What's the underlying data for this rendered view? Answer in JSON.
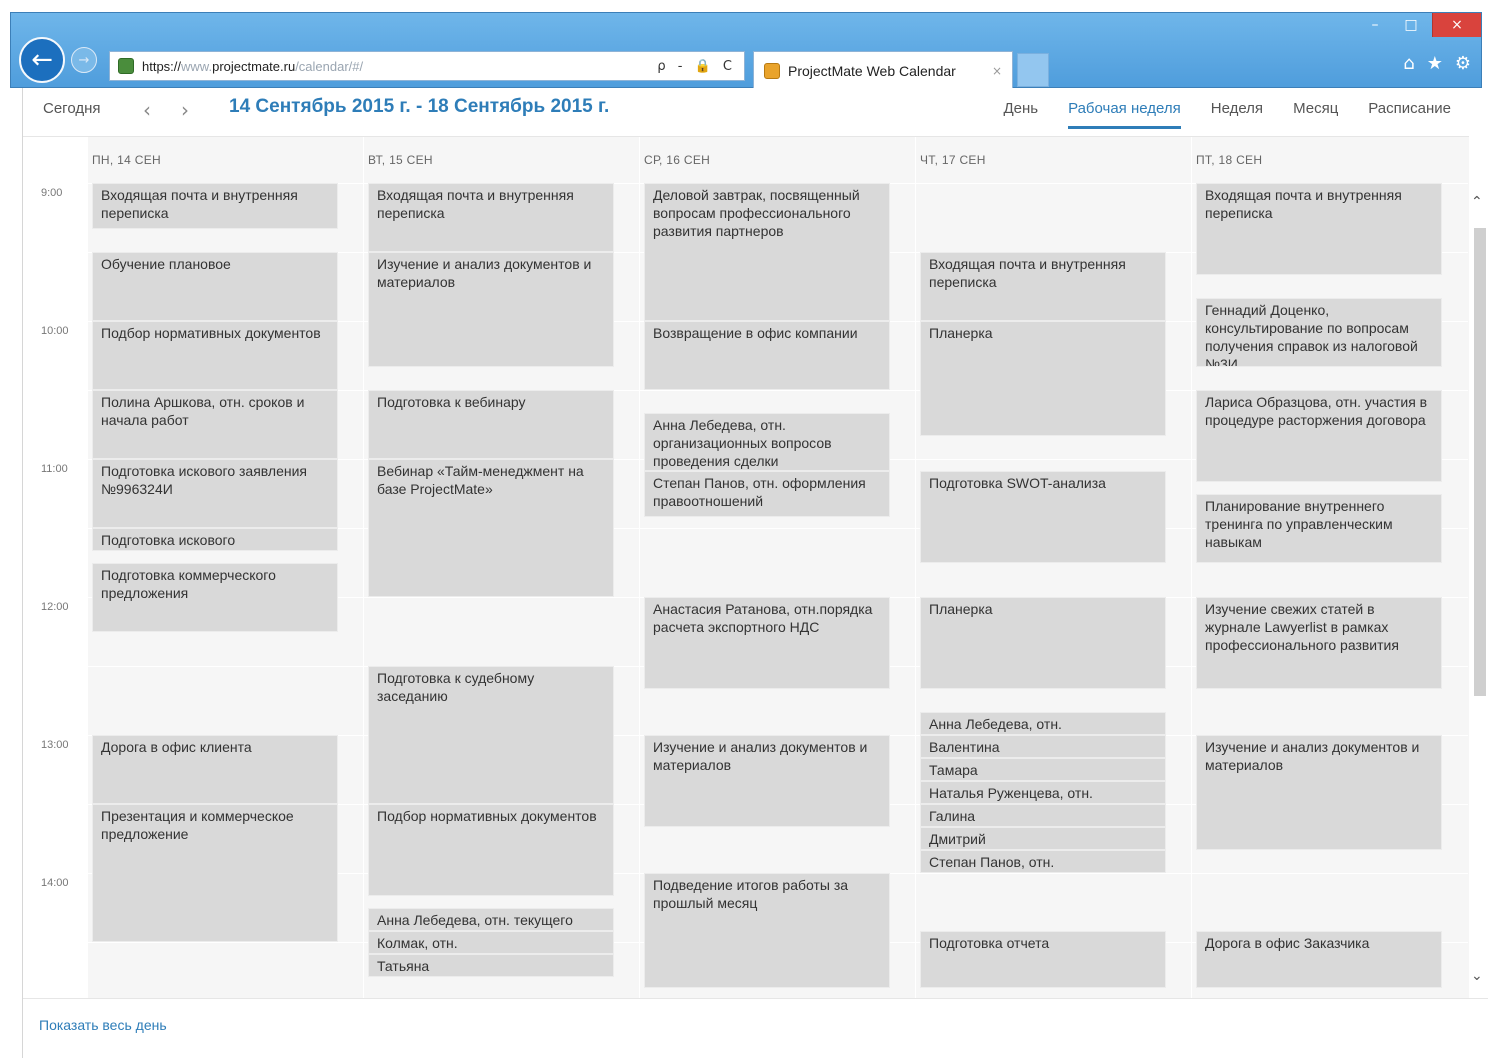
{
  "browser": {
    "url_scheme": "https://",
    "url_muted_prefix": "www.",
    "url_host": "projectmate.ru",
    "url_path": "/calendar/#/",
    "address_tools": "ρ - 🔒 C",
    "tab_title": "ProjectMate Web Calendar",
    "tab_close": "×",
    "window_min": "–",
    "window_max": "□",
    "window_close": "×",
    "tools": [
      "⌂",
      "★",
      "⚙"
    ]
  },
  "toolbar": {
    "today_label": "Сегодня",
    "prev_label": "‹",
    "next_label": "›",
    "date_range": "14 Сентябрь 2015 г. - 18 Сентябрь 2015 г.",
    "views": [
      {
        "label": "День",
        "active": false
      },
      {
        "label": "Рабочая неделя",
        "active": true
      },
      {
        "label": "Неделя",
        "active": false
      },
      {
        "label": "Месяц",
        "active": false
      },
      {
        "label": "Расписание",
        "active": false
      }
    ]
  },
  "time_labels": [
    "9:00",
    "10:00",
    "11:00",
    "12:00",
    "13:00",
    "14:00"
  ],
  "days": [
    {
      "header": "ПН, 14 СЕН",
      "events": [
        {
          "title": "Входящая почта и внутренняя переписка",
          "start": "9:00",
          "end": "9:20"
        },
        {
          "title": "Обучение плановое",
          "start": "9:30",
          "end": "10:00"
        },
        {
          "title": "Подбор нормативных документов",
          "start": "10:00",
          "end": "10:30"
        },
        {
          "title": "Полина Аршкова, отн. сроков и начала работ",
          "start": "10:30",
          "end": "11:00"
        },
        {
          "title": "Подготовка искового заявления №996324И",
          "start": "11:00",
          "end": "11:30"
        },
        {
          "title": "Подготовка искового",
          "start": "11:30",
          "end": "11:40"
        },
        {
          "title": "Подготовка коммерческого предложения",
          "start": "11:45",
          "end": "12:15"
        },
        {
          "title": "Дорога в офис клиента",
          "start": "13:00",
          "end": "13:30"
        },
        {
          "title": "Презентация и коммерческое предложение",
          "start": "13:30",
          "end": "14:30"
        }
      ]
    },
    {
      "header": "ВТ, 15 СЕН",
      "events": [
        {
          "title": "Входящая почта и внутренняя переписка",
          "start": "9:00",
          "end": "9:30"
        },
        {
          "title": "Изучение и анализ документов и материалов",
          "start": "9:30",
          "end": "10:20"
        },
        {
          "title": "Подготовка к вебинару",
          "start": "10:30",
          "end": "11:00"
        },
        {
          "title": "Вебинар «Тайм-менеджмент на базе ProjectMate»",
          "start": "11:00",
          "end": "12:00"
        },
        {
          "title": "Подготовка к судебному заседанию",
          "start": "12:30",
          "end": "13:30"
        },
        {
          "title": "Подбор нормативных документов",
          "start": "13:30",
          "end": "14:10"
        },
        {
          "title": "Анна Лебедева, отн. текущего",
          "start": "14:15",
          "end": "14:25"
        },
        {
          "title": "Колмак, отн.",
          "start": "14:25",
          "end": "14:35"
        },
        {
          "title": "Татьяна",
          "start": "14:35",
          "end": "14:45"
        }
      ]
    },
    {
      "header": "СР, 16 СЕН",
      "events": [
        {
          "title": "Деловой завтрак, посвященный вопросам профессионального развития партнеров",
          "start": "9:00",
          "end": "10:00"
        },
        {
          "title": "Возвращение в офис компании",
          "start": "10:00",
          "end": "10:30"
        },
        {
          "title": "Анна Лебедева, отн. организационных вопросов проведения сделки",
          "start": "10:40",
          "end": "11:05"
        },
        {
          "title": "Степан Панов, отн. оформления правоотношений",
          "start": "11:05",
          "end": "11:25"
        },
        {
          "title": "Анастасия Ратанова, отн.порядка расчета экспортного НДС",
          "start": "12:00",
          "end": "12:40"
        },
        {
          "title": "Изучение и анализ документов и материалов",
          "start": "13:00",
          "end": "13:40"
        },
        {
          "title": "Подведение итогов работы за прошлый месяц",
          "start": "14:00",
          "end": "14:50"
        }
      ]
    },
    {
      "header": "ЧТ, 17 СЕН",
      "events": [
        {
          "title": "Входящая почта и внутренняя переписка",
          "start": "9:30",
          "end": "10:00"
        },
        {
          "title": "Планерка",
          "start": "10:00",
          "end": "10:50"
        },
        {
          "title": "Подготовка SWOT-анализа",
          "start": "11:05",
          "end": "11:45"
        },
        {
          "title": "Планерка",
          "start": "12:00",
          "end": "12:40"
        },
        {
          "title": "Анна Лебедева, отн.",
          "start": "12:50",
          "end": "13:00"
        },
        {
          "title": "Валентина",
          "start": "13:00",
          "end": "13:10"
        },
        {
          "title": "Тамара",
          "start": "13:10",
          "end": "13:20"
        },
        {
          "title": "Наталья Руженцева, отн.",
          "start": "13:20",
          "end": "13:30"
        },
        {
          "title": "Галина",
          "start": "13:30",
          "end": "13:40"
        },
        {
          "title": "Дмитрий",
          "start": "13:40",
          "end": "13:50"
        },
        {
          "title": "Степан Панов, отн.",
          "start": "13:50",
          "end": "14:00"
        },
        {
          "title": "Подготовка отчета",
          "start": "14:25",
          "end": "14:50"
        }
      ]
    },
    {
      "header": "ПТ, 18 СЕН",
      "events": [
        {
          "title": "Входящая почта и внутренняя переписка",
          "start": "9:00",
          "end": "9:40"
        },
        {
          "title": "Геннадий Доценко, консультирование по вопросам получения справок из налоговой №3И",
          "start": "9:50",
          "end": "10:20"
        },
        {
          "title": "Лариса Образцова, отн. участия в процедуре расторжения договора",
          "start": "10:30",
          "end": "11:10"
        },
        {
          "title": "Планирование внутреннего тренинга по управленческим навыкам",
          "start": "11:15",
          "end": "11:45"
        },
        {
          "title": "Изучение свежих статей в журнале Lawyerlist в рамках профессионального развития",
          "start": "12:00",
          "end": "12:40"
        },
        {
          "title": "Изучение и анализ документов и материалов",
          "start": "13:00",
          "end": "13:50"
        },
        {
          "title": "Дорога в офис Заказчика",
          "start": "14:25",
          "end": "14:50"
        }
      ]
    }
  ],
  "footer": {
    "show_all_label": "Показать весь день"
  },
  "colors": {
    "accent": "#2e7db8",
    "event_bg": "#d9d9d9",
    "grid_bg": "#f6f6f6"
  }
}
